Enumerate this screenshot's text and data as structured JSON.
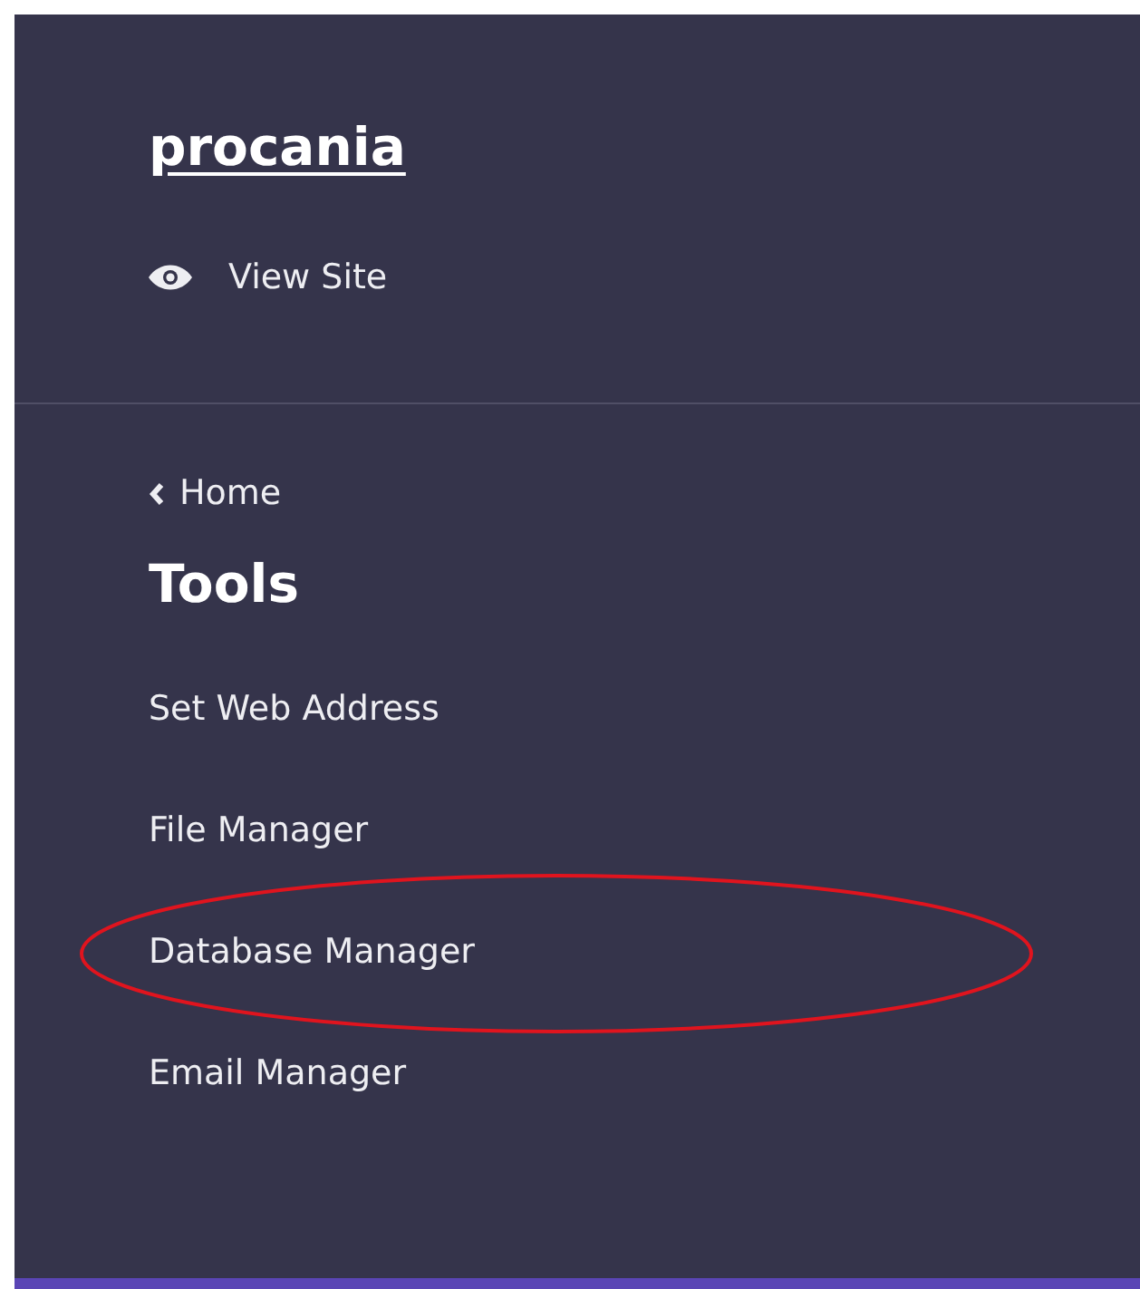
{
  "sidebar": {
    "brand": "procania",
    "view_site": "View Site",
    "back_link": "Home",
    "section_title": "Tools",
    "items": [
      {
        "label": "Set Web Address",
        "circled": false
      },
      {
        "label": "File Manager",
        "circled": false
      },
      {
        "label": "Database Manager",
        "circled": true
      },
      {
        "label": "Email Manager",
        "circled": false
      }
    ]
  }
}
